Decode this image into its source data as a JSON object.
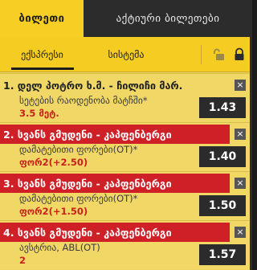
{
  "tabs": {
    "tickets": "ბილეთი",
    "active_tickets": "აქტიური ბილეთები"
  },
  "subtabs": {
    "express": "ექსპრესი",
    "system": "სისტემა"
  },
  "icons": {
    "unlock": "unlock-icon",
    "lock": "lock-icon",
    "close": "×"
  },
  "colors": {
    "accent": "#f4cc22",
    "alert": "#cf2027",
    "dark": "#2b2b2b"
  },
  "bets": [
    {
      "title": "1. დელ პოტრო ხ.მ. - ჩილიჩი მარ.",
      "market": "სეტების რაოდენობა მატჩში*",
      "pick": "3.5 მეტ.",
      "odds": "1.43",
      "highlighted": false
    },
    {
      "title": "2. სვანს გმუდენი - კაპფენბერგი",
      "market": "დამატებითი ფორები(OT)*",
      "pick": "ფორ2(+2.50)",
      "odds": "1.40",
      "highlighted": true
    },
    {
      "title": "3. სვანს გმუდენი - კაპფენბერგი",
      "market": "დამატებითი ფორები(OT)*",
      "pick": "ფორ2(+1.50)",
      "odds": "1.50",
      "highlighted": true
    },
    {
      "title": "4. სვანს გმუდენი - კაპფენბერგი",
      "market": "ავსტრია, ABL(OT)",
      "pick": "2",
      "odds": "1.57",
      "highlighted": true
    }
  ]
}
